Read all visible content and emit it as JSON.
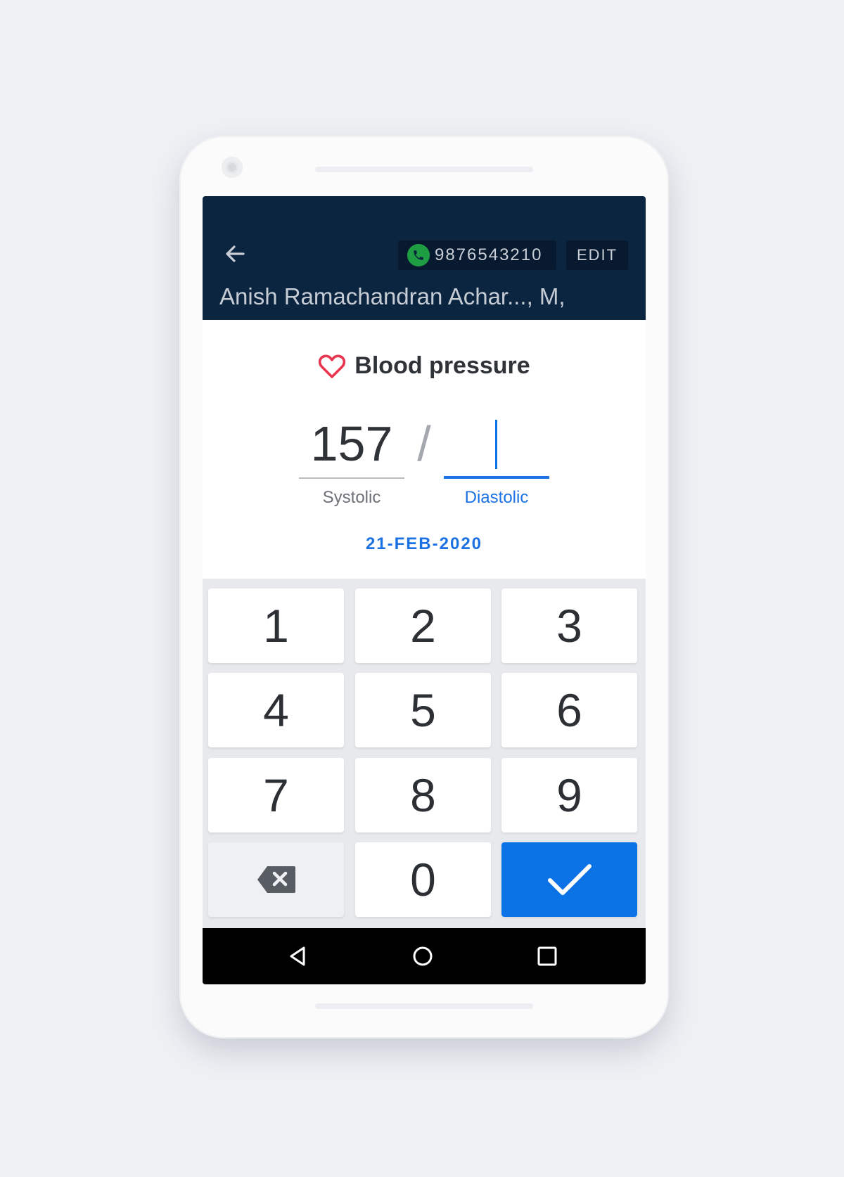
{
  "header": {
    "back_icon": "arrow-left-icon",
    "phone_icon": "phone-icon",
    "phone_number": "9876543210",
    "edit_label": "EDIT",
    "patient_name": "Anish Ramachandran Achar..., M,"
  },
  "measurement": {
    "icon": "heart-outline-icon",
    "title": "Blood pressure",
    "systolic_value": "157",
    "systolic_label": "Systolic",
    "separator": "/",
    "diastolic_value": "",
    "diastolic_label": "Diastolic",
    "date": "21-FEB-2020"
  },
  "keypad": {
    "keys": [
      "1",
      "2",
      "3",
      "4",
      "5",
      "6",
      "7",
      "8",
      "9"
    ],
    "zero": "0",
    "backspace_icon": "backspace-icon",
    "done_icon": "checkmark-icon"
  },
  "navigation": {
    "back_icon": "triangle-back-icon",
    "home_icon": "circle-home-icon",
    "recents_icon": "square-recents-icon"
  },
  "colors": {
    "appbar": "#0b2440",
    "accent": "#1c72e3",
    "heart": "#e8344e",
    "call": "#1f9d43"
  }
}
